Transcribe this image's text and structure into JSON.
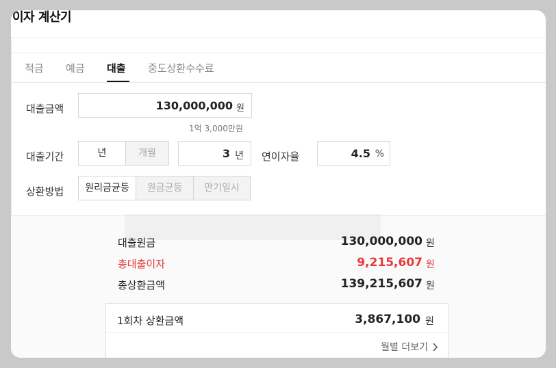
{
  "title": "이자 계산기",
  "tabs": [
    {
      "label": "적금",
      "active": false
    },
    {
      "label": "예금",
      "active": false
    },
    {
      "label": "대출",
      "active": true
    },
    {
      "label": "중도상환수수료",
      "active": false
    }
  ],
  "loan_amount": {
    "label": "대출금액",
    "value": "130,000,000",
    "unit": "원",
    "hint": "1억 3,000만원"
  },
  "loan_period": {
    "label": "대출기간",
    "unit_options": [
      "년",
      "개월"
    ],
    "selected_unit": "년",
    "value": "3",
    "unit": "년"
  },
  "interest_rate": {
    "label": "연이자율",
    "value": "4.5",
    "unit": "%"
  },
  "repayment": {
    "label": "상환방법",
    "options": [
      "원리금균등",
      "원금균등",
      "만기일시"
    ],
    "selected": "원리금균등"
  },
  "results": {
    "principal_label": "대출원금",
    "principal_value": "130,000,000",
    "interest_label": "총대출이자",
    "interest_value": "9,215,607",
    "total_label": "총상환금액",
    "total_value": "139,215,607",
    "unit": "원"
  },
  "monthly": {
    "label": "1회차 상환금액",
    "value": "3,867,100",
    "unit": "원",
    "more_label": "월별 더보기"
  },
  "colors": {
    "accent_red": "#e8383a",
    "active_text": "#111111"
  }
}
